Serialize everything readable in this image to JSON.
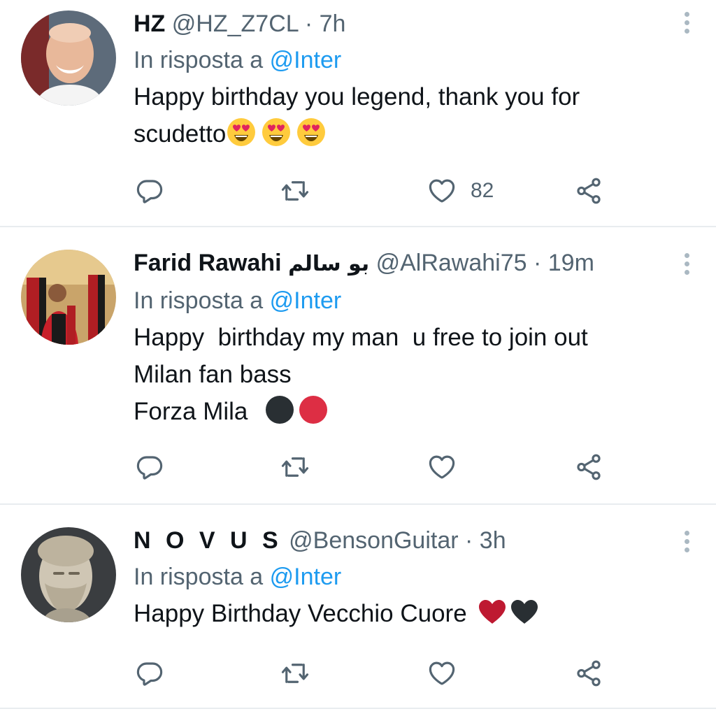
{
  "tweets": [
    {
      "name": "HZ",
      "handle": "@HZ_Z7CL",
      "time": "· 7h",
      "reply_label": "In risposta a",
      "reply_mention": "@Inter",
      "text_lines": [
        "Happy birthday you legend, thank you for",
        "scudetto"
      ],
      "emojis": [
        "heart-eyes-emoji",
        "heart-eyes-emoji",
        "heart-eyes-emoji"
      ],
      "likes": "82"
    },
    {
      "name": "Farid Rawahi",
      "name_arabic": "بو سالم",
      "handle": "@AlRawahi75",
      "time": "· 19m",
      "reply_label": "In risposta a",
      "reply_mention": "@Inter",
      "text_lines": [
        "Happy  birthday my man  u free to join out",
        "Milan fan bass",
        "Forza Mila"
      ],
      "emojis": [
        "black-circle-emoji",
        "red-circle-emoji"
      ],
      "likes": ""
    },
    {
      "name": "N O V U S",
      "handle": "@BensonGuitar",
      "time": "· 3h",
      "reply_label": "In risposta a",
      "reply_mention": "@Inter",
      "text_lines": [
        "Happy Birthday Vecchio Cuore"
      ],
      "emojis": [
        "red-heart-emoji",
        "black-heart-emoji"
      ],
      "likes": ""
    }
  ],
  "icons": {
    "reply": "reply-icon",
    "retweet": "retweet-icon",
    "like": "like-icon",
    "share": "share-icon",
    "more": "more-options-icon"
  },
  "colors": {
    "text": "#0f1419",
    "secondary": "#536471",
    "link": "#1d9bf0",
    "divider": "#e8ecef"
  }
}
